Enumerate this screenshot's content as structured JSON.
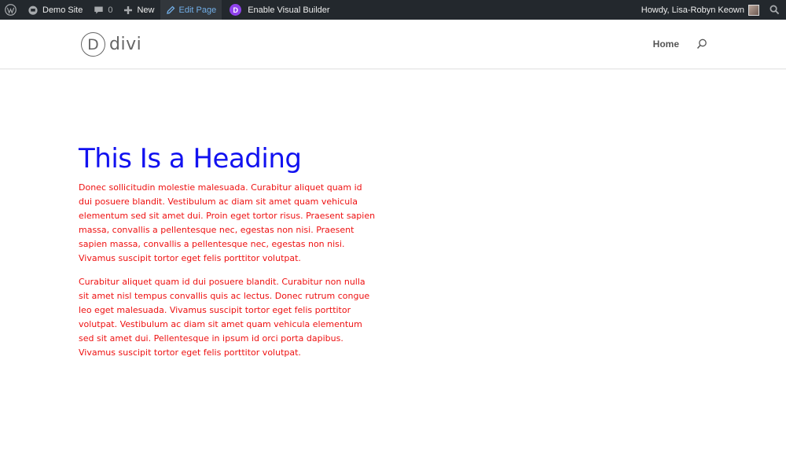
{
  "admin_bar": {
    "site_name": "Demo Site",
    "comment_count": "0",
    "new_label": "New",
    "edit_page_label": "Edit Page",
    "visual_builder_label": "Enable Visual Builder",
    "visual_builder_badge": "D",
    "greeting": "Howdy, Lisa-Robyn Keown"
  },
  "header": {
    "logo_mark": "D",
    "logo_text": "divi",
    "nav": {
      "home_label": "Home"
    }
  },
  "content": {
    "heading": "This Is a Heading",
    "paragraphs": [
      "Donec sollicitudin molestie malesuada. Curabitur aliquet quam id dui posuere blandit. Vestibulum ac diam sit amet quam vehicula elementum sed sit amet dui. Proin eget tortor risus. Praesent sapien massa, convallis a pellentesque nec, egestas non nisi. Praesent sapien massa, convallis a pellentesque nec, egestas non nisi. Vivamus suscipit tortor eget felis porttitor volutpat.",
      "Curabitur aliquet quam id dui posuere blandit. Curabitur non nulla sit amet nisl tempus convallis quis ac lectus. Donec rutrum congue leo eget malesuada. Vivamus suscipit tortor eget felis porttitor volutpat. Vestibulum ac diam sit amet quam vehicula elementum sed sit amet dui. Pellentesque in ipsum id orci porta dapibus. Vivamus suscipit tortor eget felis porttitor volutpat."
    ]
  },
  "colors": {
    "admin_bar_bg": "#23282d",
    "heading": "#1212f0",
    "body_text": "#ee1111",
    "divi_purple": "#8f42ec"
  },
  "icons": [
    "wordpress-icon",
    "site-home-icon",
    "comment-icon",
    "plus-icon",
    "pencil-icon",
    "search-icon"
  ]
}
